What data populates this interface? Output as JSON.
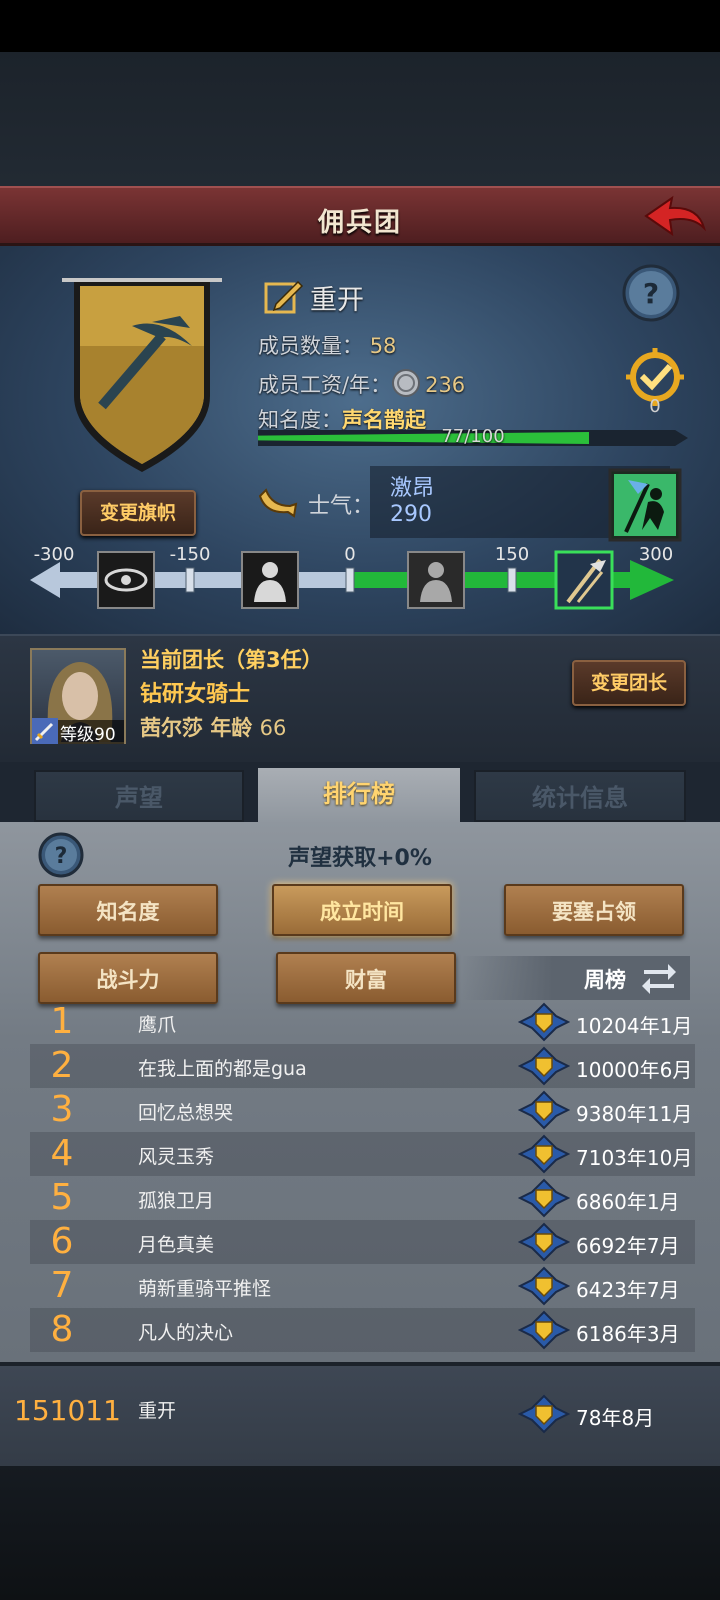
{
  "header": {
    "title": "佣兵团"
  },
  "guild": {
    "name": "重开",
    "member_count_label": "成员数量：",
    "member_count": "58",
    "wage_label": "成员工资/年：",
    "wage": "236",
    "fame_label": "知名度：",
    "fame_title": "声名鹊起",
    "fame_progress": "77/100",
    "fame_fraction": 0.77,
    "reward_count": "0",
    "change_flag_label": "变更旗帜"
  },
  "morale": {
    "label": "士气：",
    "state": "激昂",
    "value": "290",
    "scale_ticks": [
      "-300",
      "-150",
      "0",
      "150",
      "300"
    ]
  },
  "leader": {
    "title": "当前团长（第3任）",
    "class": "钻研女骑士",
    "name": "茜尔莎",
    "age_label": "年龄",
    "age": "66",
    "level": "等级90",
    "change_leader_label": "变更团长"
  },
  "tabs": [
    {
      "label": "声望",
      "active": false
    },
    {
      "label": "排行榜",
      "active": true
    },
    {
      "label": "统计信息",
      "active": false
    }
  ],
  "ranking": {
    "fame_gain": "声望获取+0%",
    "categories": [
      "知名度",
      "成立时间",
      "要塞占领",
      "战斗力",
      "财富"
    ],
    "selected_category": "成立时间",
    "period_label": "周榜",
    "rows": [
      {
        "rank": "1",
        "name": "鹰爪",
        "time": "10204年1月"
      },
      {
        "rank": "2",
        "name": "在我上面的都是gua",
        "time": "10000年6月"
      },
      {
        "rank": "3",
        "name": "回忆总想哭",
        "time": "9380年11月"
      },
      {
        "rank": "4",
        "name": "风灵玉秀",
        "time": "7103年10月"
      },
      {
        "rank": "5",
        "name": "孤狼卫月",
        "time": "6860年1月"
      },
      {
        "rank": "6",
        "name": "月色真美",
        "time": "6692年7月"
      },
      {
        "rank": "7",
        "name": "萌新重骑平推怪",
        "time": "6423年7月"
      },
      {
        "rank": "8",
        "name": "凡人的决心",
        "time": "6186年3月"
      }
    ],
    "mine": {
      "rank": "151011",
      "name": "重开",
      "time": "78年8月"
    }
  },
  "colors": {
    "header_red": "#6a2a2c",
    "accent_gold": "#ffb040",
    "fame_green": "#2bbf3a"
  }
}
